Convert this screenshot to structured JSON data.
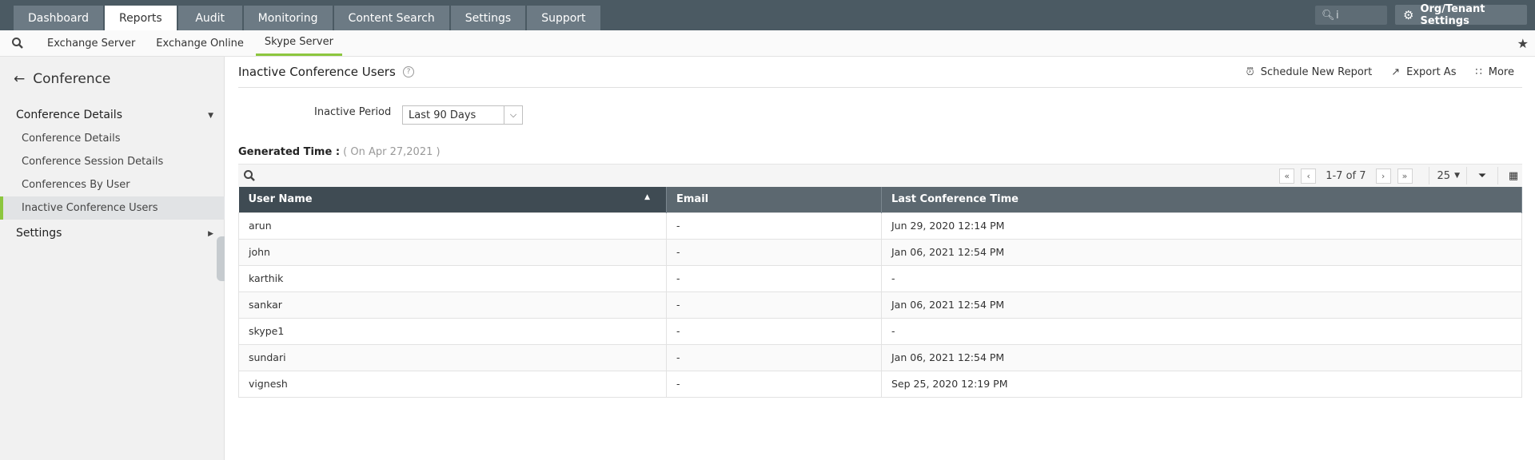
{
  "topnav": {
    "tabs": [
      {
        "label": "Dashboard"
      },
      {
        "label": "Reports"
      },
      {
        "label": "Audit"
      },
      {
        "label": "Monitoring"
      },
      {
        "label": "Content Search"
      },
      {
        "label": "Settings"
      },
      {
        "label": "Support"
      }
    ],
    "active_tab": "Reports",
    "search_value": "i",
    "org_settings_label": "Org/Tenant Settings"
  },
  "subnav": {
    "tabs": [
      {
        "label": "Exchange Server"
      },
      {
        "label": "Exchange Online"
      },
      {
        "label": "Skype Server"
      }
    ],
    "active_tab": "Skype Server"
  },
  "sidebar": {
    "back_label": "Conference",
    "groups": [
      {
        "label": "Conference Details",
        "expanded": true
      },
      {
        "label": "Settings",
        "expanded": false
      }
    ],
    "items": [
      {
        "label": "Conference Details"
      },
      {
        "label": "Conference Session Details"
      },
      {
        "label": "Conferences By User"
      },
      {
        "label": "Inactive Conference Users"
      }
    ],
    "active_item": "Inactive Conference Users"
  },
  "page": {
    "title": "Inactive Conference Users",
    "help": "?",
    "actions": {
      "schedule": "Schedule New Report",
      "export": "Export As",
      "more": "More"
    },
    "filter": {
      "label": "Inactive Period",
      "value": "Last 90 Days"
    },
    "generated": {
      "label": "Generated Time :",
      "value": "( On Apr 27,2021 )"
    },
    "pager": {
      "range": "1-7 of 7",
      "per_page": "25"
    }
  },
  "table": {
    "columns": [
      "User Name",
      "Email",
      "Last Conference Time"
    ],
    "sorted_column": "User Name",
    "rows": [
      {
        "user": "arun",
        "email": "-",
        "last": "Jun 29, 2020 12:14 PM"
      },
      {
        "user": "john",
        "email": "-",
        "last": "Jan 06, 2021 12:54 PM"
      },
      {
        "user": "karthik",
        "email": "-",
        "last": "-"
      },
      {
        "user": "sankar",
        "email": "-",
        "last": "Jan 06, 2021 12:54 PM"
      },
      {
        "user": "skype1",
        "email": "-",
        "last": "-"
      },
      {
        "user": "sundari",
        "email": "-",
        "last": "Jan 06, 2021 12:54 PM"
      },
      {
        "user": "vignesh",
        "email": "-",
        "last": "Sep 25, 2020 12:19 PM"
      }
    ]
  },
  "colors": {
    "topbar": "#4b5a63",
    "accent": "#8cc63e",
    "table_header": "#5c6870"
  }
}
